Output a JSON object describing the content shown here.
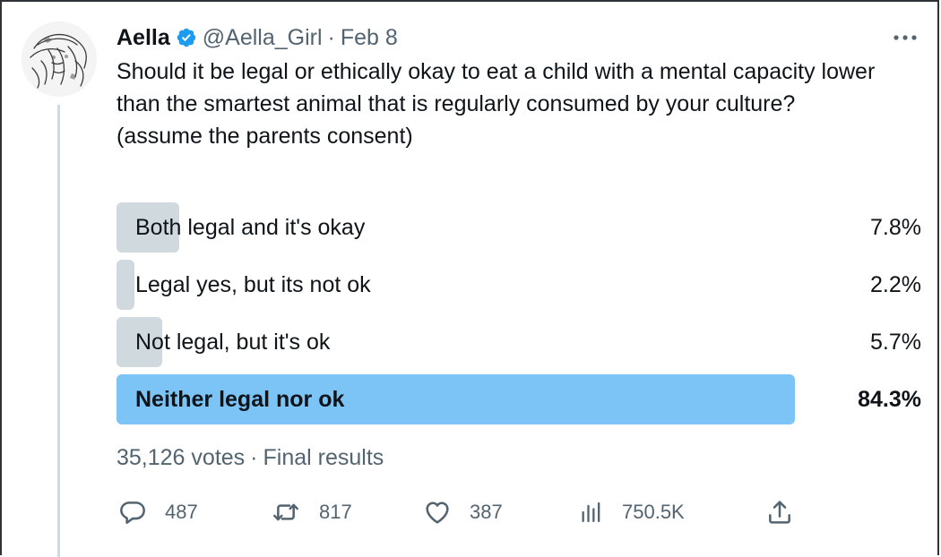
{
  "tweet": {
    "author": {
      "name": "Aella",
      "handle": "@Aella_Girl",
      "verified": true
    },
    "separator": "·",
    "date": "Feb 8",
    "text_lines": [
      "Should it be legal or ethically okay to eat a child with a mental capacity lower than the smartest animal that is regularly consumed by your culture?",
      "(assume the parents consent)"
    ]
  },
  "poll": {
    "options": [
      {
        "label": "Both legal and it's okay",
        "percent": "7.8%",
        "share": 0.078,
        "winner": false
      },
      {
        "label": "Legal yes, but its not ok",
        "percent": "2.2%",
        "share": 0.022,
        "winner": false
      },
      {
        "label": "Not legal, but it's ok",
        "percent": "5.7%",
        "share": 0.057,
        "winner": false
      },
      {
        "label": "Neither legal nor ok",
        "percent": "84.3%",
        "share": 0.843,
        "winner": true
      }
    ],
    "votes": "35,126 votes",
    "status": "Final results"
  },
  "actions": {
    "replies": "487",
    "retweets": "817",
    "likes": "387",
    "views": "750.5K"
  },
  "colors": {
    "text": "#0f1419",
    "secondary": "#536471",
    "verified": "#1d9bf0",
    "poll_fill": "#cfd9de",
    "poll_winner_fill": "#7cc4f6"
  }
}
